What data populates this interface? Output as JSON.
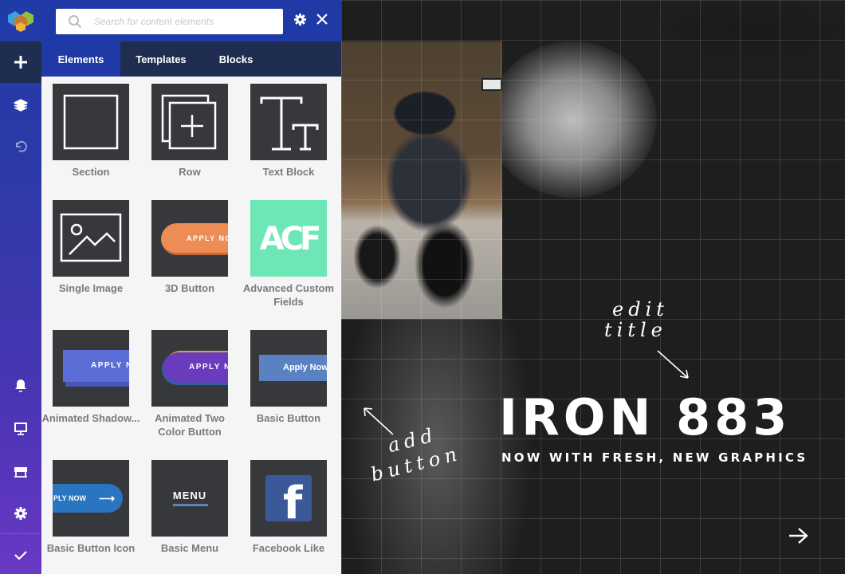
{
  "rail": {
    "logo": "vc-logo",
    "add_icon": "plus-icon",
    "items": [
      {
        "name": "layers-icon"
      },
      {
        "name": "undo-icon"
      },
      {
        "name": "bell-icon"
      },
      {
        "name": "monitor-icon"
      },
      {
        "name": "store-icon"
      },
      {
        "name": "gear-icon"
      },
      {
        "name": "check-icon"
      }
    ]
  },
  "panel": {
    "search": {
      "placeholder": "Search for content elements",
      "value": ""
    },
    "tabs": [
      {
        "label": "Elements",
        "active": true
      },
      {
        "label": "Templates",
        "active": false
      },
      {
        "label": "Blocks",
        "active": false
      }
    ],
    "elements": [
      {
        "label": "Section",
        "thumb": "section"
      },
      {
        "label": "Row",
        "thumb": "row"
      },
      {
        "label": "Text Block",
        "thumb": "text"
      },
      {
        "label": "Single Image",
        "thumb": "image"
      },
      {
        "label": "3D Button",
        "thumb": "btn3d",
        "thumb_text": "APPLY NO"
      },
      {
        "label": "Advanced Custom Fields",
        "thumb": "acf",
        "thumb_text": "ACF"
      },
      {
        "label": "Animated Shadow...",
        "thumb": "shadow",
        "thumb_text": "APPLY N"
      },
      {
        "label": "Animated Two Color Button",
        "thumb": "twocolor",
        "thumb_text": "APPLY NO"
      },
      {
        "label": "Basic Button",
        "thumb": "basic",
        "thumb_text": "Apply Now"
      },
      {
        "label": "Basic Button Icon",
        "thumb": "btnicon",
        "thumb_text": "PLY NOW"
      },
      {
        "label": "Basic Menu",
        "thumb": "menu",
        "thumb_text": "MENU"
      },
      {
        "label": "Facebook Like",
        "thumb": "fb",
        "thumb_text": "f"
      }
    ]
  },
  "canvas": {
    "headline": "IRON 883",
    "subheadline": "NOW WITH FRESH, NEW GRAPHICS",
    "annotation_title": [
      "edit",
      "title"
    ],
    "annotation_button": [
      "add",
      "button"
    ]
  },
  "colors": {
    "rail_top": "#1f3ba8",
    "rail_bottom": "#6a38c4",
    "topbar": "#1f39a6",
    "tabs_bg": "#1f2e50",
    "thumb_bg": "#37383b",
    "acf": "#6ee7b7",
    "orange": "#ee8c56",
    "purple": "#6a3bbd",
    "fb_blue": "#3b5998"
  }
}
